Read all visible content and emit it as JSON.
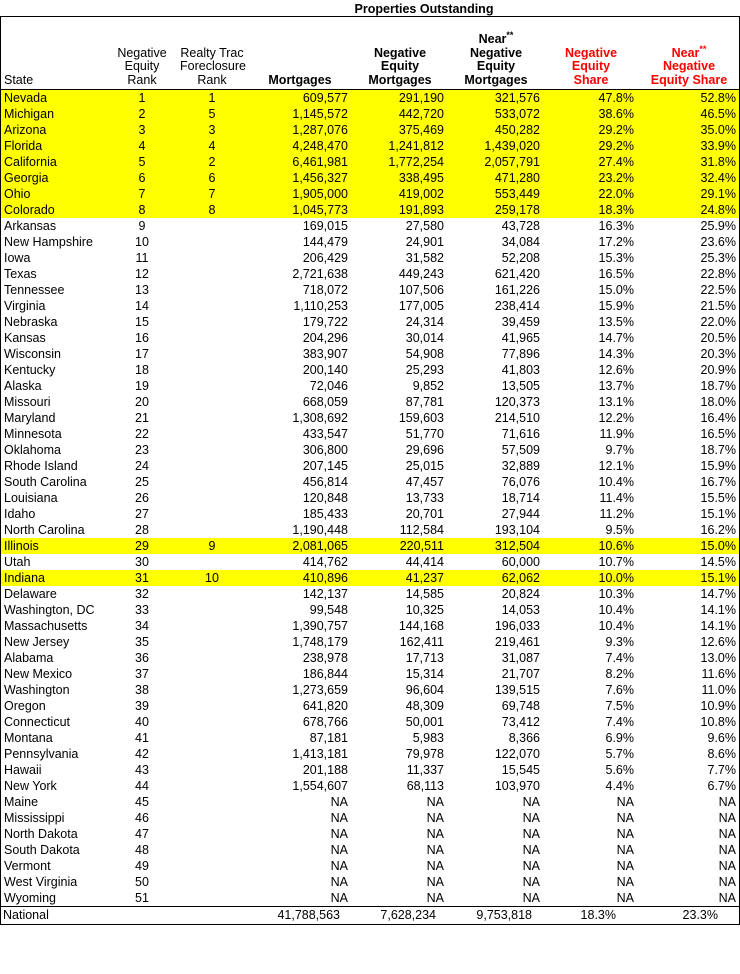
{
  "group_header": {
    "title": "Properties Outstanding"
  },
  "columns": [
    {
      "key": "state",
      "label_lines": [
        "State"
      ],
      "style": "state"
    },
    {
      "key": "ne_rank",
      "label_lines": [
        "Negative",
        "Equity",
        "Rank"
      ],
      "style": "rank"
    },
    {
      "key": "fc_rank",
      "label_lines": [
        "Realty Trac",
        "Foreclosure",
        "Rank"
      ],
      "style": "rank"
    },
    {
      "key": "mortgages",
      "label_lines": [
        "Mortgages"
      ],
      "style": "num"
    },
    {
      "key": "ne_mtg",
      "label_lines": [
        "Negative",
        "Equity",
        "Mortgages"
      ],
      "style": "num"
    },
    {
      "key": "nne_mtg",
      "label_lines": [
        "Near**",
        "Negative",
        "Equity",
        "Mortgages"
      ],
      "style": "num"
    },
    {
      "key": "ne_share",
      "label_lines": [
        "Negative",
        "Equity",
        "Share"
      ],
      "style": "red"
    },
    {
      "key": "nne_share",
      "label_lines": [
        "Near**",
        "Negative",
        "Equity Share"
      ],
      "style": "red"
    }
  ],
  "colors": {
    "highlight": "#ffff00",
    "header_accent": "#ff0000",
    "text": "#000000",
    "background": "#ffffff"
  },
  "rows": [
    {
      "state": "Nevada",
      "ne_rank": "1",
      "fc_rank": "1",
      "mortgages": "609,577",
      "ne_mtg": "291,190",
      "nne_mtg": "321,576",
      "ne_share": "47.8%",
      "nne_share": "52.8%",
      "highlight": true
    },
    {
      "state": "Michigan",
      "ne_rank": "2",
      "fc_rank": "5",
      "mortgages": "1,145,572",
      "ne_mtg": "442,720",
      "nne_mtg": "533,072",
      "ne_share": "38.6%",
      "nne_share": "46.5%",
      "highlight": true
    },
    {
      "state": "Arizona",
      "ne_rank": "3",
      "fc_rank": "3",
      "mortgages": "1,287,076",
      "ne_mtg": "375,469",
      "nne_mtg": "450,282",
      "ne_share": "29.2%",
      "nne_share": "35.0%",
      "highlight": true
    },
    {
      "state": "Florida",
      "ne_rank": "4",
      "fc_rank": "4",
      "mortgages": "4,248,470",
      "ne_mtg": "1,241,812",
      "nne_mtg": "1,439,020",
      "ne_share": "29.2%",
      "nne_share": "33.9%",
      "highlight": true
    },
    {
      "state": "California",
      "ne_rank": "5",
      "fc_rank": "2",
      "mortgages": "6,461,981",
      "ne_mtg": "1,772,254",
      "nne_mtg": "2,057,791",
      "ne_share": "27.4%",
      "nne_share": "31.8%",
      "highlight": true
    },
    {
      "state": "Georgia",
      "ne_rank": "6",
      "fc_rank": "6",
      "mortgages": "1,456,327",
      "ne_mtg": "338,495",
      "nne_mtg": "471,280",
      "ne_share": "23.2%",
      "nne_share": "32.4%",
      "highlight": true
    },
    {
      "state": "Ohio",
      "ne_rank": "7",
      "fc_rank": "7",
      "mortgages": "1,905,000",
      "ne_mtg": "419,002",
      "nne_mtg": "553,449",
      "ne_share": "22.0%",
      "nne_share": "29.1%",
      "highlight": true
    },
    {
      "state": "Colorado",
      "ne_rank": "8",
      "fc_rank": "8",
      "mortgages": "1,045,773",
      "ne_mtg": "191,893",
      "nne_mtg": "259,178",
      "ne_share": "18.3%",
      "nne_share": "24.8%",
      "highlight": true
    },
    {
      "state": "Arkansas",
      "ne_rank": "9",
      "fc_rank": "",
      "mortgages": "169,015",
      "ne_mtg": "27,580",
      "nne_mtg": "43,728",
      "ne_share": "16.3%",
      "nne_share": "25.9%",
      "highlight": false
    },
    {
      "state": "New Hampshire",
      "ne_rank": "10",
      "fc_rank": "",
      "mortgages": "144,479",
      "ne_mtg": "24,901",
      "nne_mtg": "34,084",
      "ne_share": "17.2%",
      "nne_share": "23.6%",
      "highlight": false
    },
    {
      "state": "Iowa",
      "ne_rank": "11",
      "fc_rank": "",
      "mortgages": "206,429",
      "ne_mtg": "31,582",
      "nne_mtg": "52,208",
      "ne_share": "15.3%",
      "nne_share": "25.3%",
      "highlight": false
    },
    {
      "state": "Texas",
      "ne_rank": "12",
      "fc_rank": "",
      "mortgages": "2,721,638",
      "ne_mtg": "449,243",
      "nne_mtg": "621,420",
      "ne_share": "16.5%",
      "nne_share": "22.8%",
      "highlight": false
    },
    {
      "state": "Tennessee",
      "ne_rank": "13",
      "fc_rank": "",
      "mortgages": "718,072",
      "ne_mtg": "107,506",
      "nne_mtg": "161,226",
      "ne_share": "15.0%",
      "nne_share": "22.5%",
      "highlight": false
    },
    {
      "state": "Virginia",
      "ne_rank": "14",
      "fc_rank": "",
      "mortgages": "1,110,253",
      "ne_mtg": "177,005",
      "nne_mtg": "238,414",
      "ne_share": "15.9%",
      "nne_share": "21.5%",
      "highlight": false
    },
    {
      "state": "Nebraska",
      "ne_rank": "15",
      "fc_rank": "",
      "mortgages": "179,722",
      "ne_mtg": "24,314",
      "nne_mtg": "39,459",
      "ne_share": "13.5%",
      "nne_share": "22.0%",
      "highlight": false
    },
    {
      "state": "Kansas",
      "ne_rank": "16",
      "fc_rank": "",
      "mortgages": "204,296",
      "ne_mtg": "30,014",
      "nne_mtg": "41,965",
      "ne_share": "14.7%",
      "nne_share": "20.5%",
      "highlight": false
    },
    {
      "state": "Wisconsin",
      "ne_rank": "17",
      "fc_rank": "",
      "mortgages": "383,907",
      "ne_mtg": "54,908",
      "nne_mtg": "77,896",
      "ne_share": "14.3%",
      "nne_share": "20.3%",
      "highlight": false
    },
    {
      "state": "Kentucky",
      "ne_rank": "18",
      "fc_rank": "",
      "mortgages": "200,140",
      "ne_mtg": "25,293",
      "nne_mtg": "41,803",
      "ne_share": "12.6%",
      "nne_share": "20.9%",
      "highlight": false
    },
    {
      "state": "Alaska",
      "ne_rank": "19",
      "fc_rank": "",
      "mortgages": "72,046",
      "ne_mtg": "9,852",
      "nne_mtg": "13,505",
      "ne_share": "13.7%",
      "nne_share": "18.7%",
      "highlight": false
    },
    {
      "state": "Missouri",
      "ne_rank": "20",
      "fc_rank": "",
      "mortgages": "668,059",
      "ne_mtg": "87,781",
      "nne_mtg": "120,373",
      "ne_share": "13.1%",
      "nne_share": "18.0%",
      "highlight": false
    },
    {
      "state": "Maryland",
      "ne_rank": "21",
      "fc_rank": "",
      "mortgages": "1,308,692",
      "ne_mtg": "159,603",
      "nne_mtg": "214,510",
      "ne_share": "12.2%",
      "nne_share": "16.4%",
      "highlight": false
    },
    {
      "state": "Minnesota",
      "ne_rank": "22",
      "fc_rank": "",
      "mortgages": "433,547",
      "ne_mtg": "51,770",
      "nne_mtg": "71,616",
      "ne_share": "11.9%",
      "nne_share": "16.5%",
      "highlight": false
    },
    {
      "state": "Oklahoma",
      "ne_rank": "23",
      "fc_rank": "",
      "mortgages": "306,800",
      "ne_mtg": "29,696",
      "nne_mtg": "57,509",
      "ne_share": "9.7%",
      "nne_share": "18.7%",
      "highlight": false
    },
    {
      "state": "Rhode Island",
      "ne_rank": "24",
      "fc_rank": "",
      "mortgages": "207,145",
      "ne_mtg": "25,015",
      "nne_mtg": "32,889",
      "ne_share": "12.1%",
      "nne_share": "15.9%",
      "highlight": false
    },
    {
      "state": "South Carolina",
      "ne_rank": "25",
      "fc_rank": "",
      "mortgages": "456,814",
      "ne_mtg": "47,457",
      "nne_mtg": "76,076",
      "ne_share": "10.4%",
      "nne_share": "16.7%",
      "highlight": false
    },
    {
      "state": "Louisiana",
      "ne_rank": "26",
      "fc_rank": "",
      "mortgages": "120,848",
      "ne_mtg": "13,733",
      "nne_mtg": "18,714",
      "ne_share": "11.4%",
      "nne_share": "15.5%",
      "highlight": false
    },
    {
      "state": "Idaho",
      "ne_rank": "27",
      "fc_rank": "",
      "mortgages": "185,433",
      "ne_mtg": "20,701",
      "nne_mtg": "27,944",
      "ne_share": "11.2%",
      "nne_share": "15.1%",
      "highlight": false
    },
    {
      "state": "North Carolina",
      "ne_rank": "28",
      "fc_rank": "",
      "mortgages": "1,190,448",
      "ne_mtg": "112,584",
      "nne_mtg": "193,104",
      "ne_share": "9.5%",
      "nne_share": "16.2%",
      "highlight": false
    },
    {
      "state": "Illinois",
      "ne_rank": "29",
      "fc_rank": "9",
      "mortgages": "2,081,065",
      "ne_mtg": "220,511",
      "nne_mtg": "312,504",
      "ne_share": "10.6%",
      "nne_share": "15.0%",
      "highlight": true
    },
    {
      "state": "Utah",
      "ne_rank": "30",
      "fc_rank": "",
      "mortgages": "414,762",
      "ne_mtg": "44,414",
      "nne_mtg": "60,000",
      "ne_share": "10.7%",
      "nne_share": "14.5%",
      "highlight": false
    },
    {
      "state": "Indiana",
      "ne_rank": "31",
      "fc_rank": "10",
      "mortgages": "410,896",
      "ne_mtg": "41,237",
      "nne_mtg": "62,062",
      "ne_share": "10.0%",
      "nne_share": "15.1%",
      "highlight": true
    },
    {
      "state": "Delaware",
      "ne_rank": "32",
      "fc_rank": "",
      "mortgages": "142,137",
      "ne_mtg": "14,585",
      "nne_mtg": "20,824",
      "ne_share": "10.3%",
      "nne_share": "14.7%",
      "highlight": false
    },
    {
      "state": "Washington, DC",
      "ne_rank": "33",
      "fc_rank": "",
      "mortgages": "99,548",
      "ne_mtg": "10,325",
      "nne_mtg": "14,053",
      "ne_share": "10.4%",
      "nne_share": "14.1%",
      "highlight": false
    },
    {
      "state": "Massachusetts",
      "ne_rank": "34",
      "fc_rank": "",
      "mortgages": "1,390,757",
      "ne_mtg": "144,168",
      "nne_mtg": "196,033",
      "ne_share": "10.4%",
      "nne_share": "14.1%",
      "highlight": false
    },
    {
      "state": "New Jersey",
      "ne_rank": "35",
      "fc_rank": "",
      "mortgages": "1,748,179",
      "ne_mtg": "162,411",
      "nne_mtg": "219,461",
      "ne_share": "9.3%",
      "nne_share": "12.6%",
      "highlight": false
    },
    {
      "state": "Alabama",
      "ne_rank": "36",
      "fc_rank": "",
      "mortgages": "238,978",
      "ne_mtg": "17,713",
      "nne_mtg": "31,087",
      "ne_share": "7.4%",
      "nne_share": "13.0%",
      "highlight": false
    },
    {
      "state": "New Mexico",
      "ne_rank": "37",
      "fc_rank": "",
      "mortgages": "186,844",
      "ne_mtg": "15,314",
      "nne_mtg": "21,707",
      "ne_share": "8.2%",
      "nne_share": "11.6%",
      "highlight": false
    },
    {
      "state": "Washington",
      "ne_rank": "38",
      "fc_rank": "",
      "mortgages": "1,273,659",
      "ne_mtg": "96,604",
      "nne_mtg": "139,515",
      "ne_share": "7.6%",
      "nne_share": "11.0%",
      "highlight": false
    },
    {
      "state": "Oregon",
      "ne_rank": "39",
      "fc_rank": "",
      "mortgages": "641,820",
      "ne_mtg": "48,309",
      "nne_mtg": "69,748",
      "ne_share": "7.5%",
      "nne_share": "10.9%",
      "highlight": false
    },
    {
      "state": "Connecticut",
      "ne_rank": "40",
      "fc_rank": "",
      "mortgages": "678,766",
      "ne_mtg": "50,001",
      "nne_mtg": "73,412",
      "ne_share": "7.4%",
      "nne_share": "10.8%",
      "highlight": false
    },
    {
      "state": "Montana",
      "ne_rank": "41",
      "fc_rank": "",
      "mortgages": "87,181",
      "ne_mtg": "5,983",
      "nne_mtg": "8,366",
      "ne_share": "6.9%",
      "nne_share": "9.6%",
      "highlight": false
    },
    {
      "state": "Pennsylvania",
      "ne_rank": "42",
      "fc_rank": "",
      "mortgages": "1,413,181",
      "ne_mtg": "79,978",
      "nne_mtg": "122,070",
      "ne_share": "5.7%",
      "nne_share": "8.6%",
      "highlight": false
    },
    {
      "state": "Hawaii",
      "ne_rank": "43",
      "fc_rank": "",
      "mortgages": "201,188",
      "ne_mtg": "11,337",
      "nne_mtg": "15,545",
      "ne_share": "5.6%",
      "nne_share": "7.7%",
      "highlight": false
    },
    {
      "state": "New York",
      "ne_rank": "44",
      "fc_rank": "",
      "mortgages": "1,554,607",
      "ne_mtg": "68,113",
      "nne_mtg": "103,970",
      "ne_share": "4.4%",
      "nne_share": "6.7%",
      "highlight": false
    },
    {
      "state": "Maine",
      "ne_rank": "45",
      "fc_rank": "",
      "mortgages": "NA",
      "ne_mtg": "NA",
      "nne_mtg": "NA",
      "ne_share": "NA",
      "nne_share": "NA",
      "highlight": false
    },
    {
      "state": "Mississippi",
      "ne_rank": "46",
      "fc_rank": "",
      "mortgages": "NA",
      "ne_mtg": "NA",
      "nne_mtg": "NA",
      "ne_share": "NA",
      "nne_share": "NA",
      "highlight": false
    },
    {
      "state": "North Dakota",
      "ne_rank": "47",
      "fc_rank": "",
      "mortgages": "NA",
      "ne_mtg": "NA",
      "nne_mtg": "NA",
      "ne_share": "NA",
      "nne_share": "NA",
      "highlight": false
    },
    {
      "state": "South Dakota",
      "ne_rank": "48",
      "fc_rank": "",
      "mortgages": "NA",
      "ne_mtg": "NA",
      "nne_mtg": "NA",
      "ne_share": "NA",
      "nne_share": "NA",
      "highlight": false
    },
    {
      "state": "Vermont",
      "ne_rank": "49",
      "fc_rank": "",
      "mortgages": "NA",
      "ne_mtg": "NA",
      "nne_mtg": "NA",
      "ne_share": "NA",
      "nne_share": "NA",
      "highlight": false
    },
    {
      "state": "West Virginia",
      "ne_rank": "50",
      "fc_rank": "",
      "mortgages": "NA",
      "ne_mtg": "NA",
      "nne_mtg": "NA",
      "ne_share": "NA",
      "nne_share": "NA",
      "highlight": false
    },
    {
      "state": "Wyoming",
      "ne_rank": "51",
      "fc_rank": "",
      "mortgages": "NA",
      "ne_mtg": "NA",
      "nne_mtg": "NA",
      "ne_share": "NA",
      "nne_share": "NA",
      "highlight": false
    }
  ],
  "total_row": {
    "state": "National",
    "ne_rank": "",
    "fc_rank": "",
    "mortgages": "41,788,563",
    "ne_mtg": "7,628,234",
    "nne_mtg": "9,753,818",
    "ne_share": "18.3%",
    "nne_share": "23.3%"
  }
}
